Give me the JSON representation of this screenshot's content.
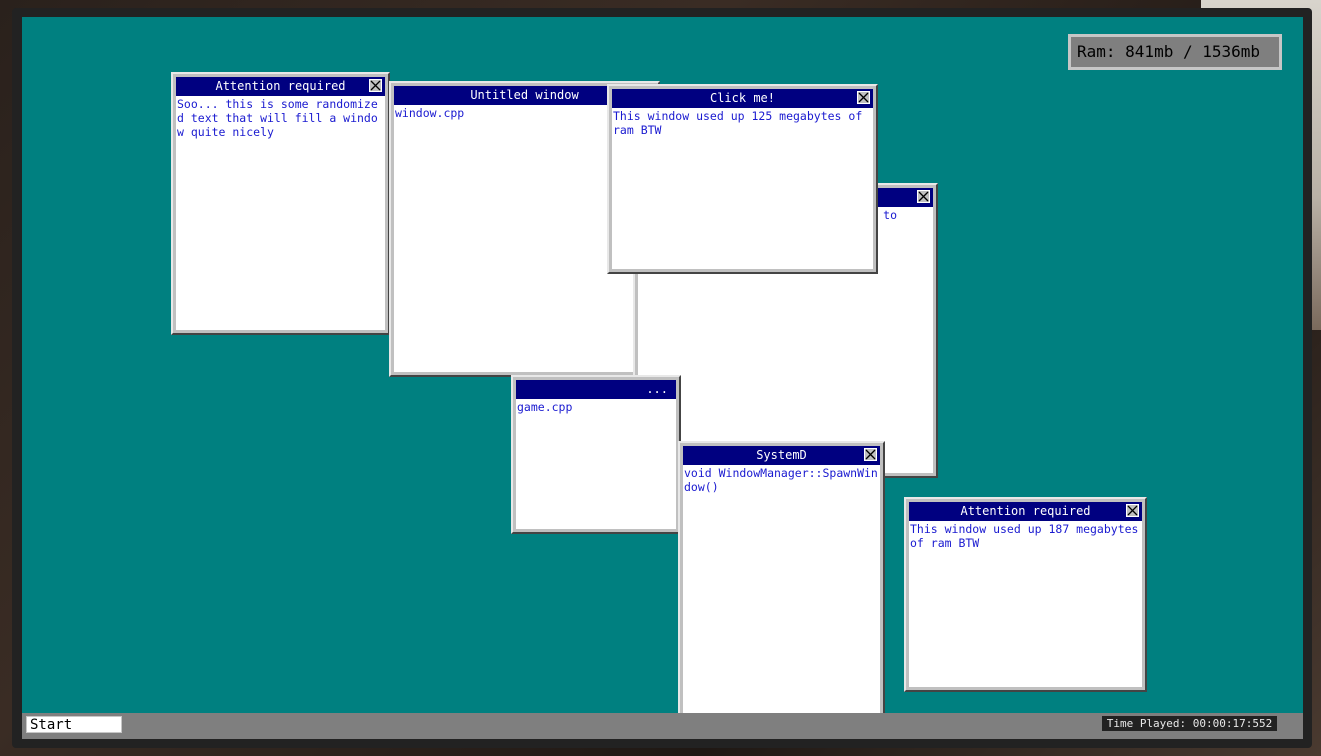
{
  "ram": {
    "label": "Ram: 841mb / 1536mb"
  },
  "windows": [
    {
      "title": "Attention required",
      "text": "Soo... this is some randomized text that will fill a window quite nicely"
    },
    {
      "title": "Untitled window",
      "text": "window.cpp"
    },
    {
      "title": "",
      "text": "to"
    },
    {
      "title": "...",
      "text": "game.cpp"
    },
    {
      "title": "Click me!",
      "text": "This window used up 125 megabytes of ram BTW"
    },
    {
      "title": "SystemD",
      "text": "void WindowManager::SpawnWindow()"
    },
    {
      "title": "Attention required",
      "text": "This window used up 187 megabytes of ram BTW"
    }
  ],
  "taskbar": {
    "start_label": "Start",
    "time_played": "Time Played: 00:00:17:552"
  },
  "colors": {
    "desktop": "#008080",
    "titlebar": "#000080",
    "window_text": "#1a1ad0"
  }
}
